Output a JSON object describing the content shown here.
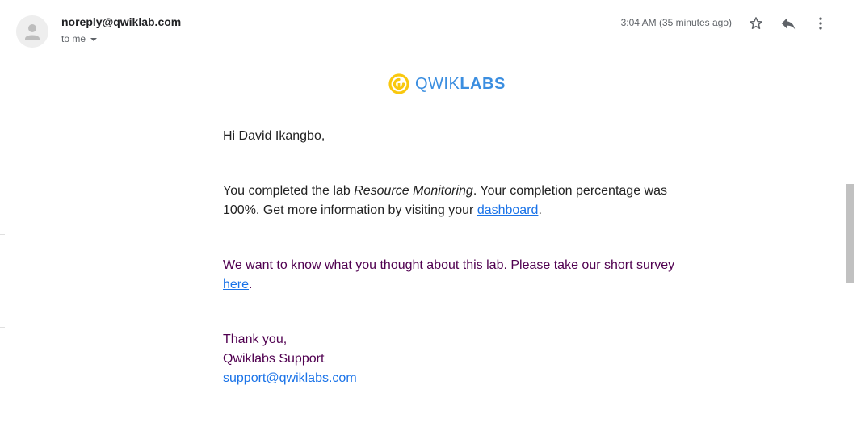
{
  "header": {
    "sender": "noreply@qwiklab.com",
    "recipient": "to me",
    "timestamp": "3:04 AM (35 minutes ago)",
    "icons": {
      "avatar": "default-avatar-icon",
      "star": "star-icon",
      "reply": "reply-icon",
      "more": "more-vert-icon",
      "recipient_caret": "caret-down-icon"
    }
  },
  "logo": {
    "text_light": "QWIK",
    "text_bold": "LABS",
    "mark_color": "#f9c80e",
    "text_color": "#3b8ee0"
  },
  "body": {
    "greeting": "Hi David Ikangbo,",
    "completion": {
      "prefix": "You completed the lab ",
      "lab_name": "Resource Monitoring",
      "middle": ". Your completion percentage was 100%. Get more information by visiting your ",
      "link_text": "dashboard",
      "suffix": "."
    },
    "survey": {
      "prefix": "We want to know what you thought about this lab. Please take our short survey ",
      "link_text": "here",
      "suffix": "."
    },
    "signoff": {
      "line1": "Thank you,",
      "line2": "Qwiklabs Support",
      "email_link": "support@qwiklabs.com"
    }
  },
  "colors": {
    "link": "#1a73e8",
    "quoted_text": "#500050",
    "scroll_thumb": "#c1c1c1"
  }
}
